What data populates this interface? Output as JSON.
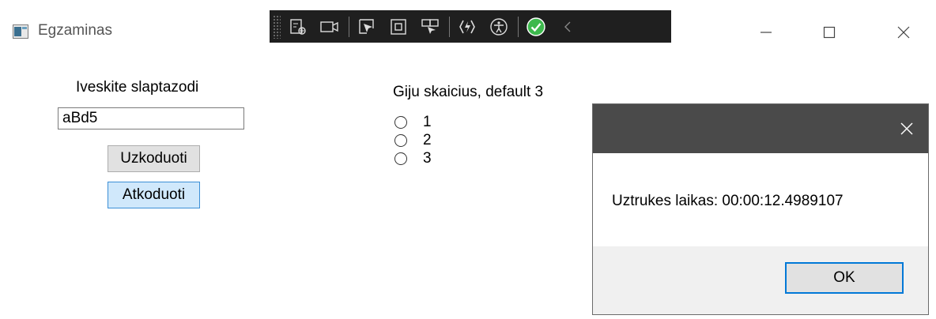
{
  "window": {
    "title": "Egzaminas",
    "icon": "app-window-icon",
    "controls": [
      "minimize-icon",
      "maximize-icon",
      "close-icon"
    ]
  },
  "debug_toolbar": {
    "buttons": [
      "live-visual-tree-icon",
      "record-video-icon",
      "select-element-icon",
      "display-layout-adorners-icon",
      "track-focus-icon",
      "hot-reload-icon",
      "accessibility-checker-icon",
      "binding-check-ok-icon",
      "collapse-chevron-icon"
    ],
    "ok_color": "#3db94d"
  },
  "form": {
    "password_label": "Iveskite slaptazodi",
    "password_value": "aBd5",
    "encode_button": "Uzkoduoti",
    "decode_button": "Atkoduoti",
    "threads_label": "Giju skaicius, default 3",
    "thread_options": [
      "1",
      "2",
      "3"
    ]
  },
  "message_box": {
    "message": "Uztrukes laikas: 00:00:12.4989107",
    "ok_button": "OK"
  }
}
